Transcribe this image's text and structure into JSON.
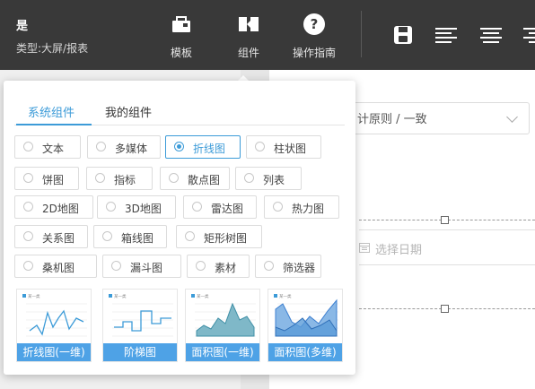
{
  "header": {
    "doc_title": "是",
    "doc_type": "类型:大屏/报表",
    "buttons": [
      {
        "label": "模板",
        "icon": "template-icon"
      },
      {
        "label": "组件",
        "icon": "component-icon"
      },
      {
        "label": "操作指南",
        "icon": "help-icon"
      }
    ],
    "toolbar_icons": [
      "save-icon",
      "align-left-icon",
      "align-center-icon",
      "align-right-icon"
    ]
  },
  "background": {
    "select_value": "计原则 / 一致",
    "date_placeholder": "选择日期"
  },
  "popup": {
    "tabs": [
      "系统组件",
      "我的组件"
    ],
    "active_tab": 0,
    "options": [
      [
        "文本",
        "多媒体",
        "折线图",
        "柱状图"
      ],
      [
        "饼图",
        "指标",
        "散点图",
        "列表"
      ],
      [
        "2D地图",
        "3D地图",
        "雷达图",
        "热力图"
      ],
      [
        "关系图",
        "箱线图",
        "矩形树图"
      ],
      [
        "桑机图",
        "漏斗图",
        "素材",
        "筛选器"
      ]
    ],
    "selected_option": "折线图",
    "thumbnails": [
      "折线图(一维)",
      "阶梯图",
      "面积图(一维)",
      "面积图(多维)"
    ],
    "thumb_legend": "某一类"
  },
  "colors": {
    "topbar": "#393939",
    "accent": "#3c9bd8",
    "thumb_caption": "#4ea2e6"
  }
}
